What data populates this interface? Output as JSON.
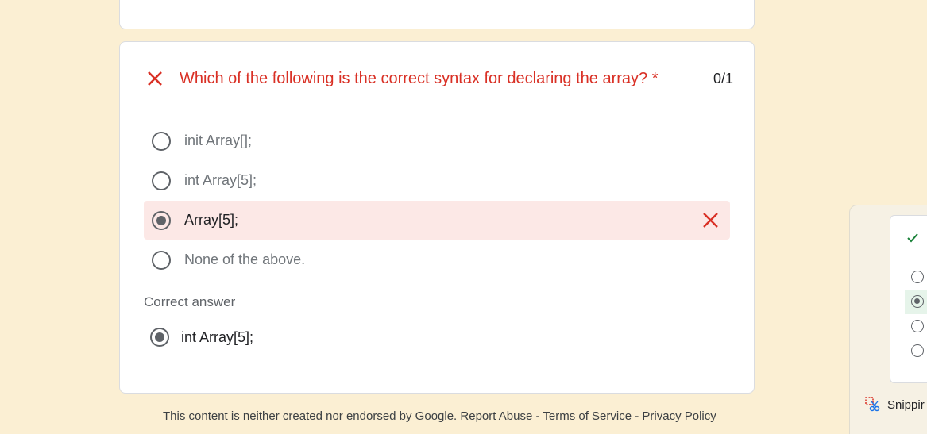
{
  "question": {
    "title": "Which of the following is the correct syntax for declaring the array? *",
    "score": "0/1",
    "options": [
      {
        "label": "init Array[];",
        "selected": false
      },
      {
        "label": "int Array[5];",
        "selected": false
      },
      {
        "label": "Array[5];",
        "selected": true,
        "marked_wrong": true
      },
      {
        "label": "None of the above.",
        "selected": false
      }
    ],
    "correct_heading": "Correct answer",
    "correct_answer": "int Array[5];"
  },
  "footer": {
    "notice": "This content is neither created nor endorsed by Google.",
    "report_abuse": "Report Abuse",
    "separator": " - ",
    "terms": "Terms of Service",
    "privacy": "Privacy Policy"
  },
  "side_panel": {
    "snipping_label": "Snippir",
    "radios": [
      false,
      true,
      false,
      false
    ]
  },
  "colors": {
    "background": "#fbefd3",
    "error": "#d93025",
    "wrong_bg": "#fce8e6",
    "success": "#188038"
  },
  "icons": [
    "close-x-icon",
    "wrong-x-icon",
    "checkmark-icon",
    "snipping-tool-icon"
  ]
}
